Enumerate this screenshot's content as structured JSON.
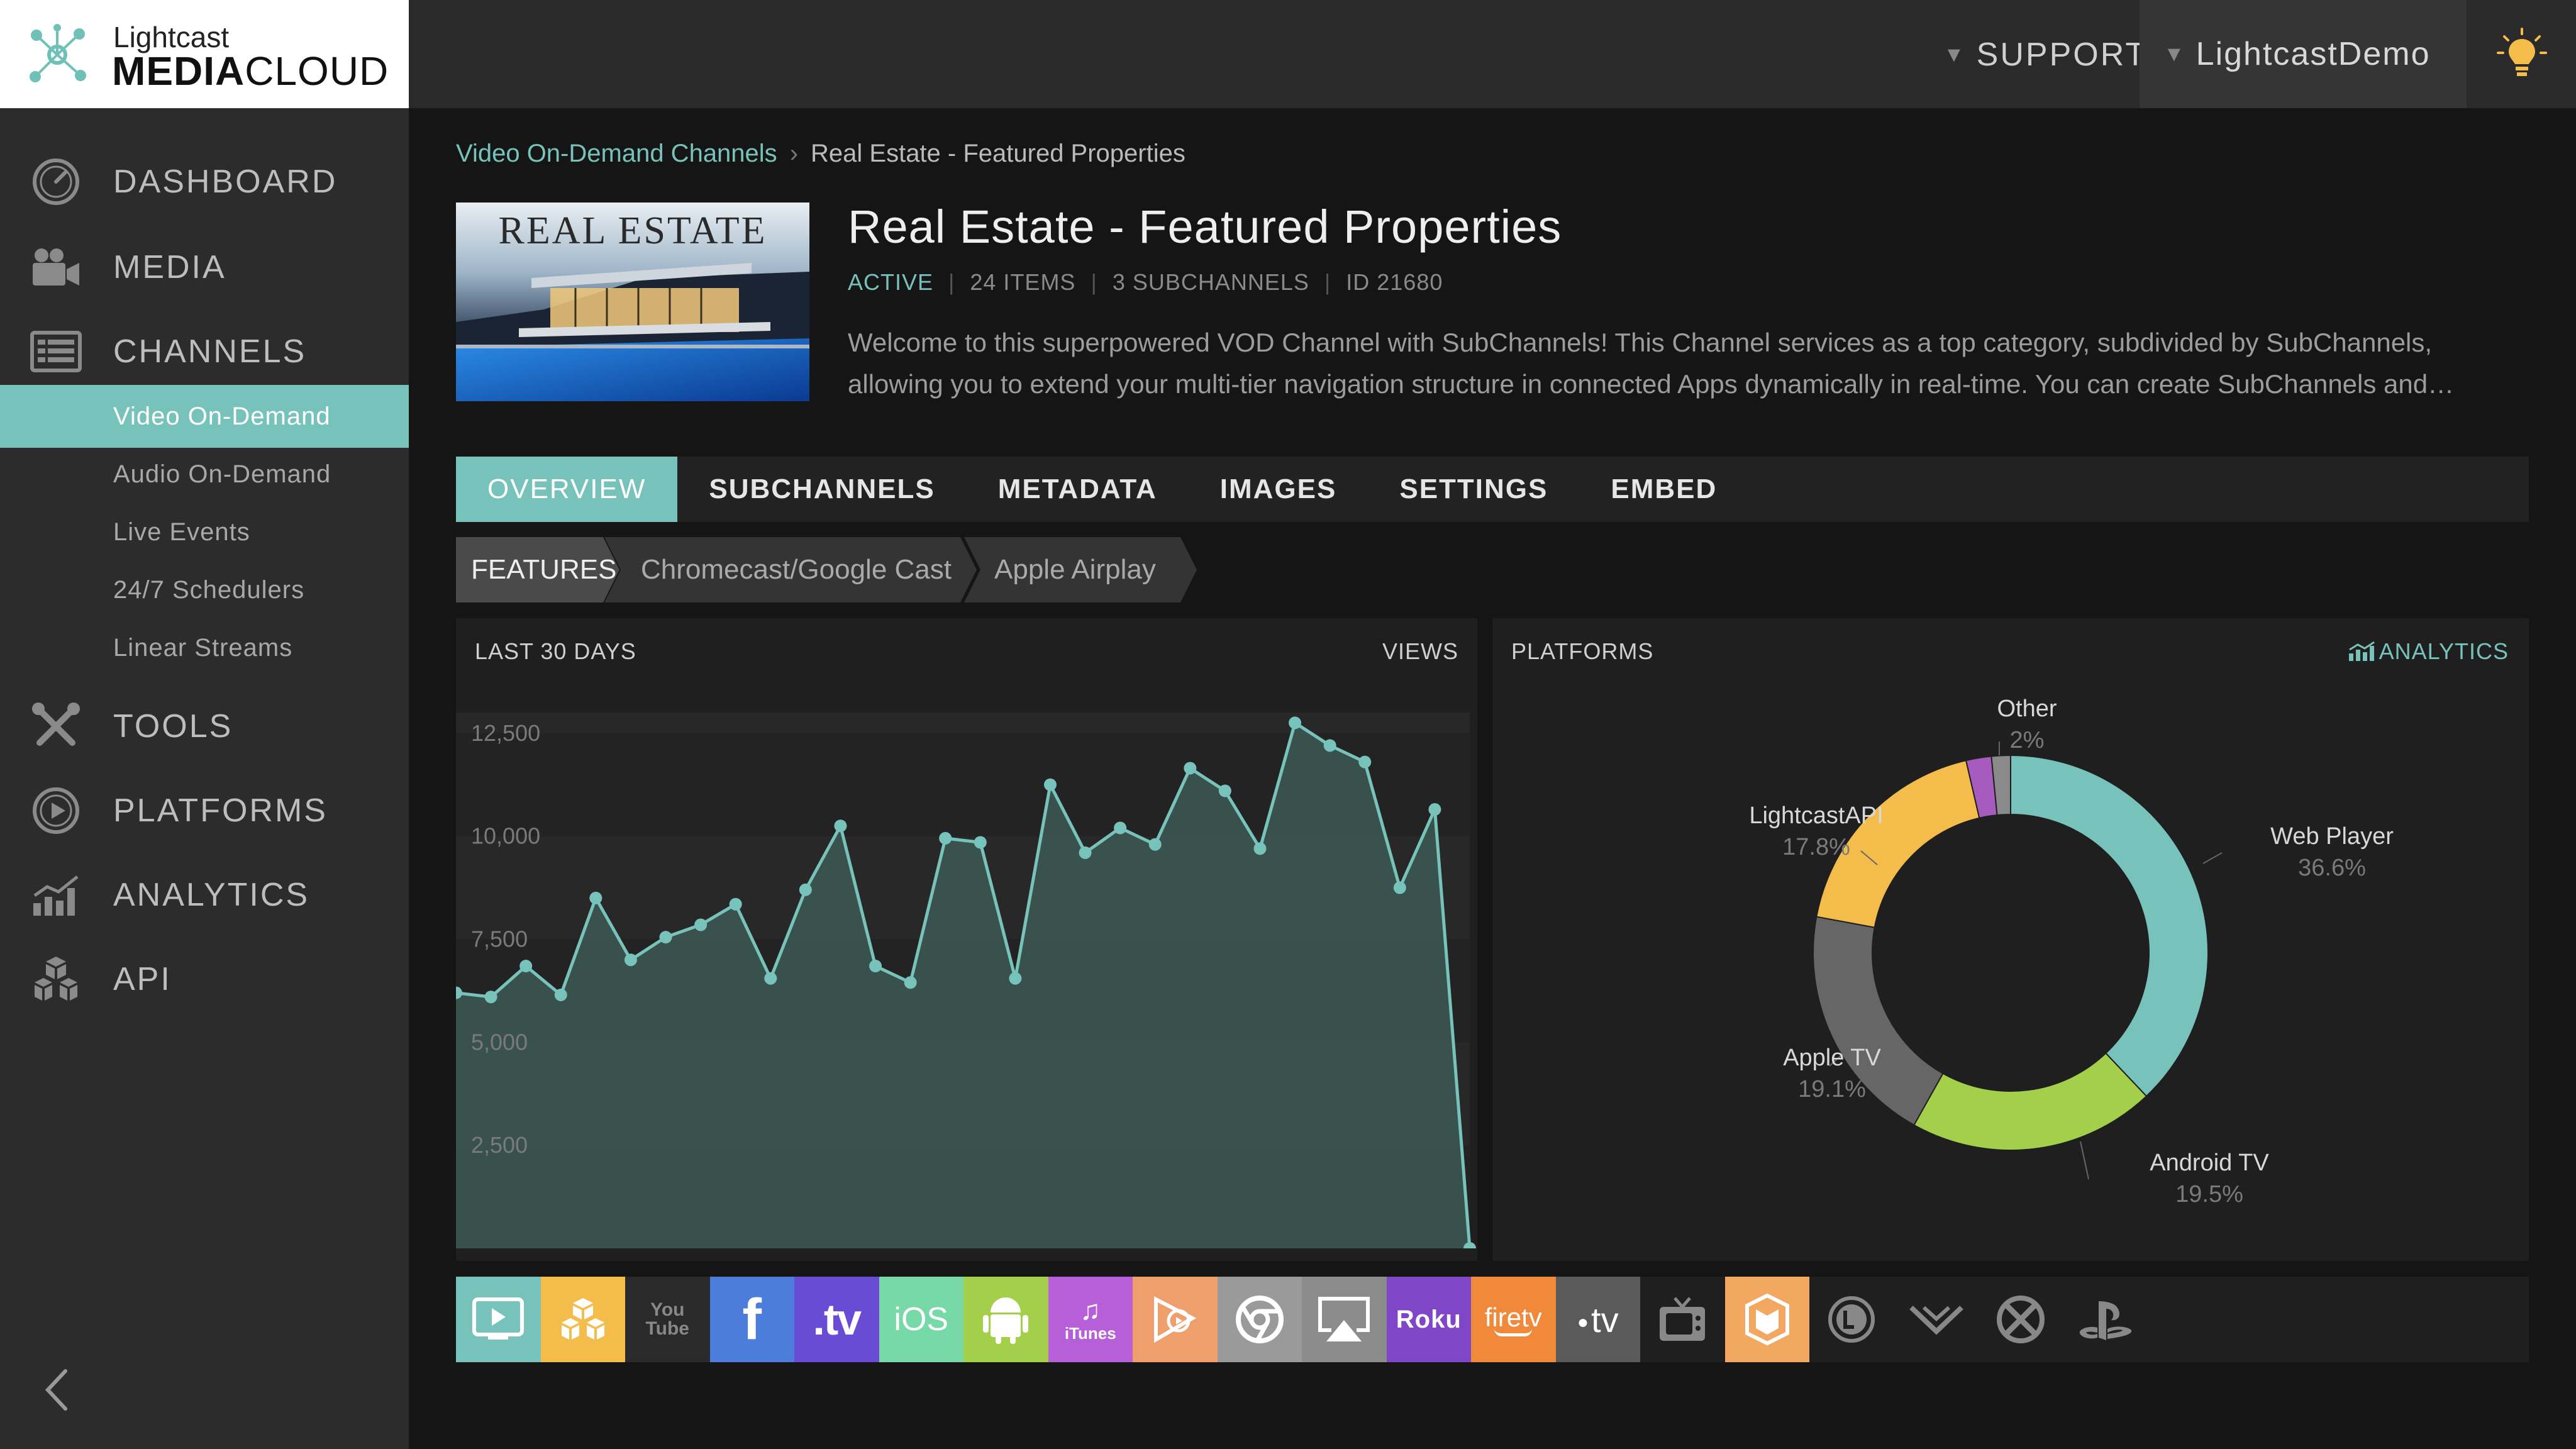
{
  "brand": {
    "line1": "Lightcast",
    "line2_bold": "MEDIA",
    "line2_rest": "CLOUD"
  },
  "topbar": {
    "support_label": "SUPPORT",
    "user_label": "LightcastDemo"
  },
  "sidebar": {
    "main_items": [
      {
        "label": "DASHBOARD",
        "icon": "dashboard-icon"
      },
      {
        "label": "MEDIA",
        "icon": "video-camera-icon"
      },
      {
        "label": "CHANNELS",
        "icon": "channels-icon"
      },
      {
        "label": "TOOLS",
        "icon": "tools-icon"
      },
      {
        "label": "PLATFORMS",
        "icon": "play-circle-icon"
      },
      {
        "label": "ANALYTICS",
        "icon": "analytics-icon"
      },
      {
        "label": "API",
        "icon": "cubes-icon"
      }
    ],
    "channel_subitems": [
      {
        "label": "Video On-Demand",
        "active": true
      },
      {
        "label": "Audio On-Demand",
        "active": false
      },
      {
        "label": "Live Events",
        "active": false
      },
      {
        "label": "24/7 Schedulers",
        "active": false
      },
      {
        "label": "Linear Streams",
        "active": false
      }
    ]
  },
  "breadcrumb": {
    "parent": "Video On-Demand Channels",
    "current": "Real Estate - Featured Properties"
  },
  "channel": {
    "thumbnail_title": "REAL ESTATE",
    "title": "Real Estate - Featured Properties",
    "status": "ACTIVE",
    "items": "24 ITEMS",
    "subchannels": "3 SUBCHANNELS",
    "id": "ID 21680",
    "description": "Welcome to this superpowered VOD Channel with SubChannels! This Channel services as a top category, subdivided by SubChannels, allowing you to extend your multi-tier navigation structure in connected Apps dynamically in real-time. You can create SubChannels and…"
  },
  "tabs": [
    "OVERVIEW",
    "SUBCHANNELS",
    "METADATA",
    "IMAGES",
    "SETTINGS",
    "EMBED"
  ],
  "features": [
    "FEATURES",
    "Chromecast/Google Cast",
    "Apple Airplay"
  ],
  "views_panel": {
    "title": "LAST 30 DAYS",
    "metric": "VIEWS"
  },
  "platforms_panel": {
    "title": "PLATFORMS",
    "analytics_link": "ANALYTICS"
  },
  "chart_data": [
    {
      "type": "area",
      "title": "LAST 30 DAYS",
      "ylabel": "VIEWS",
      "y_ticks": [
        "12,500",
        "10,000",
        "7,500",
        "5,000",
        "2,500"
      ],
      "ylim": [
        0,
        13000
      ],
      "values": [
        6200,
        6100,
        6850,
        6150,
        8500,
        7000,
        7550,
        7850,
        8350,
        6550,
        8700,
        10250,
        6850,
        6450,
        9950,
        9850,
        6550,
        11250,
        9600,
        10200,
        9800,
        11650,
        11100,
        9700,
        12750,
        12200,
        11800,
        8750,
        10650,
        0
      ],
      "color": "#77c3bb"
    },
    {
      "type": "pie",
      "title": "PLATFORMS",
      "slices": [
        {
          "label": "Web Player",
          "value": 36.6,
          "display": "36.6%",
          "color": "#77c3bb"
        },
        {
          "label": "Android TV",
          "value": 19.5,
          "display": "19.5%",
          "color": "#a3cf4a"
        },
        {
          "label": "Apple TV",
          "value": 19.1,
          "display": "19.1%",
          "color": "#666666"
        },
        {
          "label": "LightcastAPI",
          "value": 17.8,
          "display": "17.8%",
          "color": "#f3bc4b"
        },
        {
          "label": "Other",
          "value": 2,
          "display": "2%",
          "color": "#a75bbf"
        },
        {
          "label": "",
          "value": 1.5,
          "display": "",
          "color": "#8a8a8a"
        }
      ]
    }
  ],
  "platform_icons": [
    {
      "name": "tv-player-icon",
      "bg": "#77c3bb",
      "text": ""
    },
    {
      "name": "cubes-platform-icon",
      "bg": "#f3bc4b",
      "text": ""
    },
    {
      "name": "youtube-icon",
      "bg": "#2a2a2a",
      "text": "You Tube"
    },
    {
      "name": "facebook-icon",
      "bg": "#4d7ddb",
      "text": "f"
    },
    {
      "name": "dot-tv-icon",
      "bg": "#6a4bd6",
      "text": ".tv"
    },
    {
      "name": "ios-icon",
      "bg": "#77d9a8",
      "text": "iOS"
    },
    {
      "name": "android-icon",
      "bg": "#a3cf4a",
      "text": ""
    },
    {
      "name": "itunes-icon",
      "bg": "#b65fd9",
      "text": "iTunes"
    },
    {
      "name": "google-play-icon",
      "bg": "#ef9f6c",
      "text": ""
    },
    {
      "name": "chrome-icon",
      "bg": "#9a9a9a",
      "text": ""
    },
    {
      "name": "airplay-icon",
      "bg": "#8c8c8c",
      "text": ""
    },
    {
      "name": "roku-icon",
      "bg": "#8046c8",
      "text": "Roku"
    },
    {
      "name": "firetv-icon",
      "bg": "#f08a3a",
      "text": "firetv"
    },
    {
      "name": "apple-tv-icon",
      "bg": "#5a5a5a",
      "text": "tv"
    },
    {
      "name": "retro-tv-icon",
      "bg": "#1f1f1f",
      "text": ""
    },
    {
      "name": "box-platform-icon",
      "bg": "#f2a861",
      "text": ""
    },
    {
      "name": "lg-icon",
      "bg": "#1f1f1f",
      "text": ""
    },
    {
      "name": "vizio-icon",
      "bg": "#1f1f1f",
      "text": ""
    },
    {
      "name": "xbox-icon",
      "bg": "#1f1f1f",
      "text": ""
    },
    {
      "name": "playstation-icon",
      "bg": "#1f1f1f",
      "text": ""
    }
  ]
}
